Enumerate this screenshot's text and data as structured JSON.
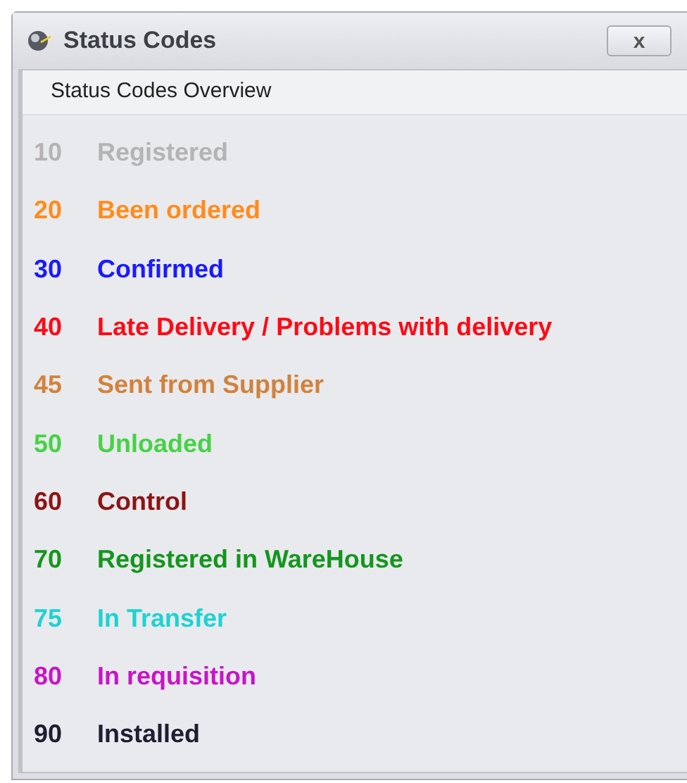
{
  "window": {
    "title": "Status Codes",
    "close": "x"
  },
  "header": "Status Codes Overview",
  "statuses": [
    {
      "code": "10",
      "label": "Registered",
      "color": "#b4b4b4"
    },
    {
      "code": "20",
      "label": "Been ordered",
      "color": "#ff8c1a"
    },
    {
      "code": "30",
      "label": "Confirmed",
      "color": "#1a1aff"
    },
    {
      "code": "40",
      "label": "Late Delivery / Problems with delivery",
      "color": "#ff0a14"
    },
    {
      "code": "45",
      "label": "Sent from Supplier",
      "color": "#d2823c"
    },
    {
      "code": "50",
      "label": "Unloaded",
      "color": "#46d246"
    },
    {
      "code": "60",
      "label": "Control",
      "color": "#8c1414"
    },
    {
      "code": "70",
      "label": "Registered in WareHouse",
      "color": "#14961e"
    },
    {
      "code": "75",
      "label": "In Transfer",
      "color": "#1ed2d2"
    },
    {
      "code": "80",
      "label": "In requisition",
      "color": "#c814c8"
    },
    {
      "code": "90",
      "label": "Installed",
      "color": "#1e1e32"
    }
  ]
}
